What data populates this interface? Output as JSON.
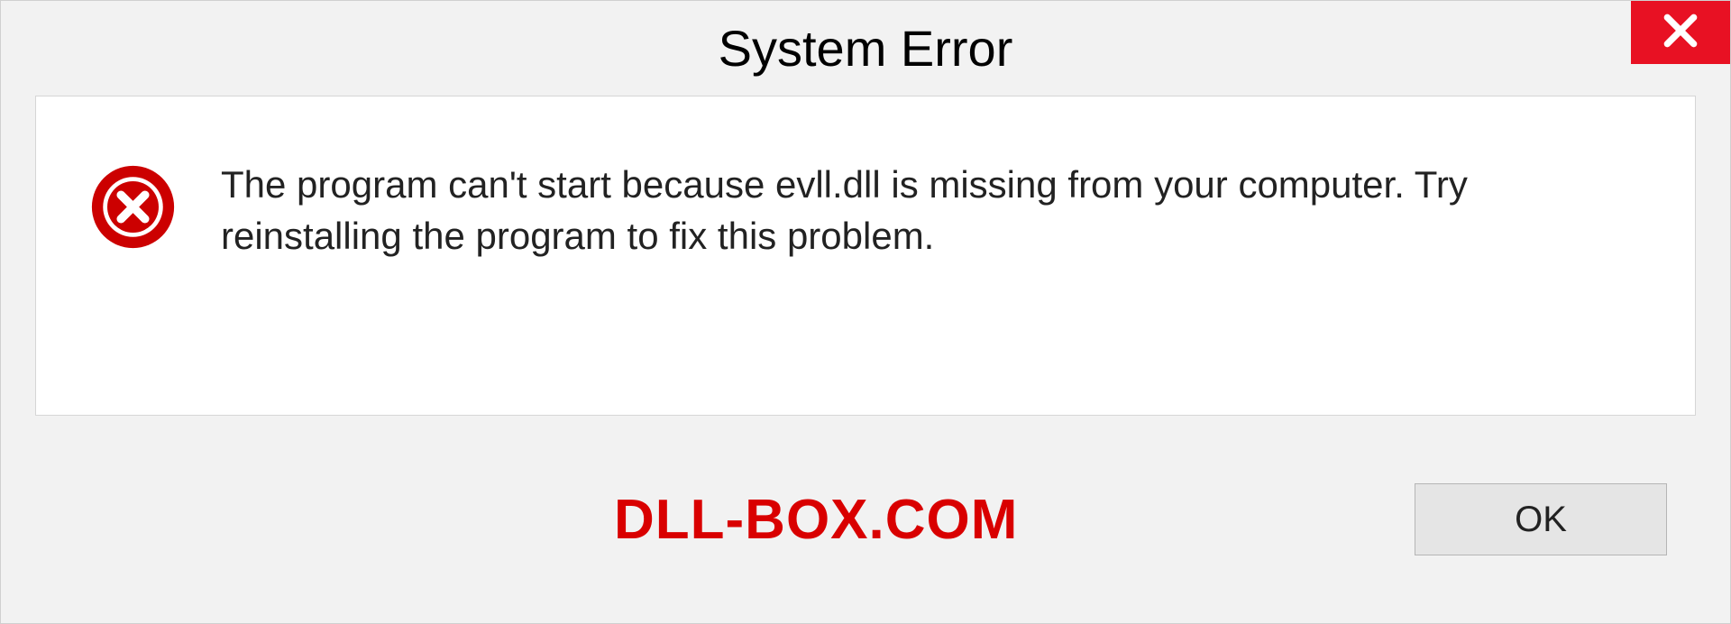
{
  "dialog": {
    "title": "System Error",
    "message": "The program can't start because evll.dll is missing from your computer. Try reinstalling the program to fix this problem.",
    "ok_label": "OK"
  },
  "watermark": "DLL-BOX.COM",
  "colors": {
    "close_bg": "#e81123",
    "error_icon": "#cc0000",
    "watermark": "#d90000"
  }
}
